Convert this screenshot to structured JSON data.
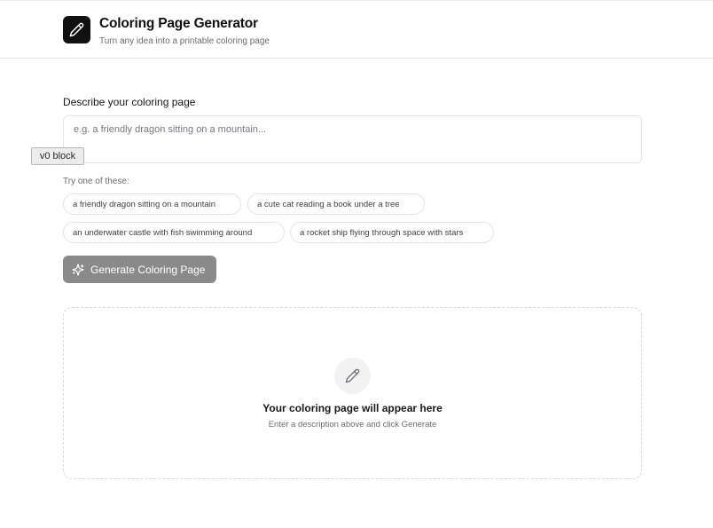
{
  "header": {
    "title": "Coloring Page Generator",
    "subtitle": "Turn any idea into a printable coloring page",
    "logo_icon": "pencil-icon"
  },
  "prompt": {
    "label": "Describe your coloring page",
    "value": "",
    "placeholder": "e.g. a friendly dragon sitting on a mountain..."
  },
  "badge": {
    "label": "v0 block"
  },
  "suggestions": {
    "label": "Try one of these:",
    "items": [
      "a friendly dragon sitting on a mountain",
      "a cute cat reading a book under a tree",
      "an underwater castle with fish swimming around",
      "a rocket ship flying through space with stars"
    ]
  },
  "generate": {
    "label": "Generate Coloring Page",
    "icon": "sparkles-icon",
    "state": "disabled"
  },
  "result": {
    "icon": "pencil-icon",
    "title": "Your coloring page will appear here",
    "subtitle": "Enter a description above and click Generate"
  },
  "colors": {
    "logo_bg": "#111111",
    "button_disabled_bg": "#8a8a8a",
    "border": "#e4e4e7"
  }
}
